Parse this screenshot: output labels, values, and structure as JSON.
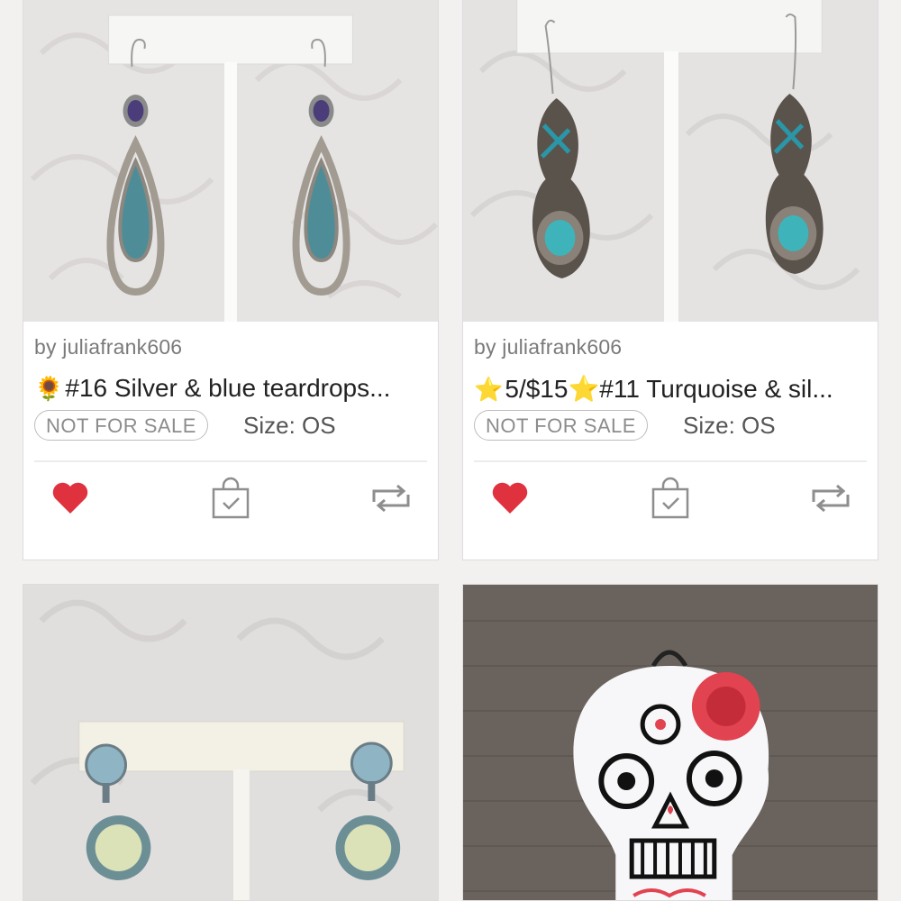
{
  "listings": [
    {
      "seller": "by juliafrank606",
      "title_emoji": "🌻",
      "title": "#16 Silver & blue teardrops...",
      "badge": "NOT FOR SALE",
      "size": "Size: OS",
      "liked": true,
      "image": "silver-blue-teardrop-earrings"
    },
    {
      "seller": "by juliafrank606",
      "title_emoji": "⭐",
      "title": "5/$15⭐#11 Turquoise & sil...",
      "badge": "NOT FOR SALE",
      "size": "Size: OS",
      "liked": true,
      "image": "turquoise-silver-earrings"
    },
    {
      "image": "opal-crystal-drop-earrings"
    },
    {
      "image": "sugar-skull-ornament"
    }
  ],
  "colors": {
    "heart": "#e0313f",
    "icon_gray": "#8e8e8e",
    "page_bg": "#f2f1f0"
  }
}
